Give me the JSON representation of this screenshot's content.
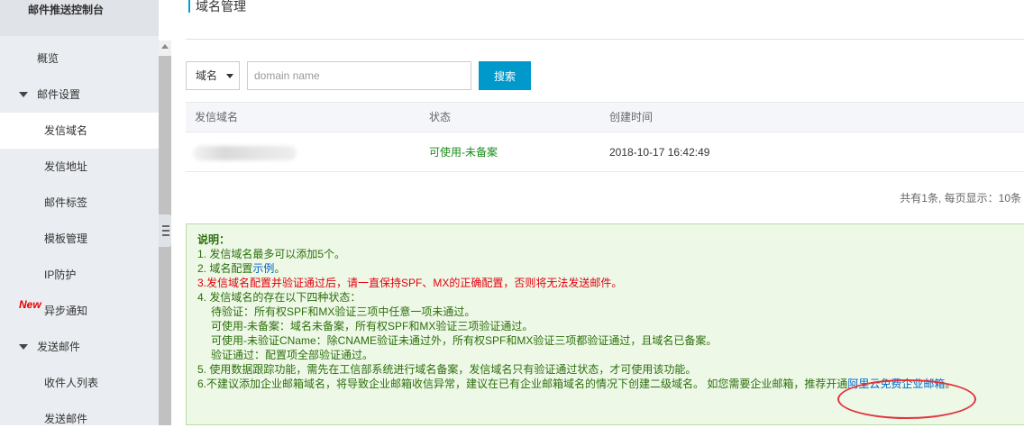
{
  "sidebar": {
    "title": "邮件推送控制台",
    "overview": "概览",
    "group_mail_settings": "邮件设置",
    "items_mail": [
      "发信域名",
      "发信地址",
      "邮件标签",
      "模板管理",
      "IP防护",
      "异步通知"
    ],
    "new_badge": "New",
    "group_send": "发送邮件",
    "items_send": [
      "收件人列表",
      "发送邮件"
    ]
  },
  "page": {
    "title": "域名管理"
  },
  "search": {
    "type_selected": "域名",
    "placeholder": "domain name",
    "button": "搜索"
  },
  "table": {
    "headers": [
      "发信域名",
      "状态",
      "创建时间"
    ],
    "rows": [
      {
        "domain": "",
        "status": "可使用-未备案",
        "created": "2018-10-17 16:42:49"
      }
    ]
  },
  "pager": {
    "text": "共有1条, 每页显示：10条"
  },
  "notice": {
    "title": "说明：",
    "l1": "1. 发信域名最多可以添加5个。",
    "l2_prefix": "2. 域名配置",
    "l2_link": "示例",
    "l2_suffix": "。",
    "l3": "3.发信域名配置并验证通过后，请一直保持SPF、MX的正确配置，否则将无法发送邮件。",
    "l4": "4. 发信域名的存在以下四种状态：",
    "l4a": "待验证：所有权SPF和MX验证三项中任意一项未通过。",
    "l4b": "可使用-未备案：域名未备案，所有权SPF和MX验证三项验证通过。",
    "l4c": "可使用-未验证CName：除CNAME验证未通过外，所有权SPF和MX验证三项都验证通过，且域名已备案。",
    "l4d": "验证通过：配置项全部验证通过。",
    "l5": "5. 使用数据跟踪功能，需先在工信部系统进行域名备案，发信域名只有验证通过状态，才可使用该功能。",
    "l6_prefix": "6.不建议添加企业邮箱域名，将导致企业邮箱收信异常，建议在已有企业邮箱域名的情况下创建二级域名。 如您需要企业邮箱，推荐开通",
    "l6_link": "阿里云免费企业邮箱",
    "l6_suffix": "。"
  },
  "colors": {
    "accent": "#0099cc",
    "status_ok": "#1a8c1a",
    "notice_bg": "#edf8e6",
    "warning": "#e4000f",
    "annotation": "#e2323c"
  }
}
